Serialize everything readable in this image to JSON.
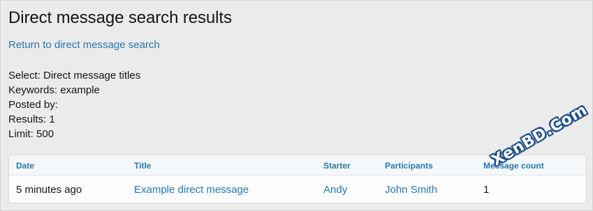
{
  "page": {
    "title": "Direct message search results",
    "return_link": "Return to direct message search"
  },
  "criteria": [
    {
      "label": "Select: Direct message titles"
    },
    {
      "label": "Keywords: example"
    },
    {
      "label": "Posted by:"
    },
    {
      "label": "Results: 1"
    },
    {
      "label": "Limit: 500"
    }
  ],
  "table": {
    "columns": [
      "Date",
      "Title",
      "Starter",
      "Participants",
      "Message count"
    ],
    "rows": [
      {
        "date": "5 minutes ago",
        "title": "Example direct message",
        "starter": "Andy",
        "participants": "John Smith",
        "message_count": "1"
      }
    ]
  },
  "watermark": {
    "text": "XenBD.Com"
  },
  "colors": {
    "background": "#ebebeb",
    "link": "#2577b1",
    "text": "#141414",
    "table_header_bg": "#f5f8fb",
    "watermark_outline": "#1f4e87"
  }
}
